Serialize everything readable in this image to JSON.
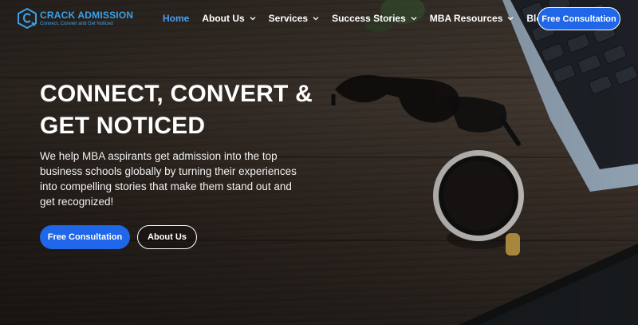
{
  "brand": {
    "name": "CRACK ADMISSION",
    "tagline": "Connect, Convert and Get Noticed"
  },
  "nav": {
    "items": [
      {
        "label": "Home",
        "active": true,
        "has_dropdown": false
      },
      {
        "label": "About Us",
        "active": false,
        "has_dropdown": true
      },
      {
        "label": "Services",
        "active": false,
        "has_dropdown": true
      },
      {
        "label": "Success Stories",
        "active": false,
        "has_dropdown": true
      },
      {
        "label": "MBA Resources",
        "active": false,
        "has_dropdown": true
      },
      {
        "label": "Blogs",
        "active": false,
        "has_dropdown": false
      }
    ],
    "cta_label": "Free Consultation"
  },
  "hero": {
    "title_line1": "CONNECT, CONVERT &",
    "title_line2": "GET NOTICED",
    "description": "We help MBA aspirants get admission into the top business schools globally by turning their experiences into compelling stories that make them stand out and get recognized!",
    "primary_button": "Free Consultation",
    "secondary_button": "About Us"
  },
  "colors": {
    "accent": "#1f66e8",
    "brand_blue": "#3aa0e8",
    "active_nav": "#4d9cf0"
  },
  "icons": {
    "logo": "crack-admission-logo-icon",
    "dropdown": "chevron-down-icon"
  }
}
